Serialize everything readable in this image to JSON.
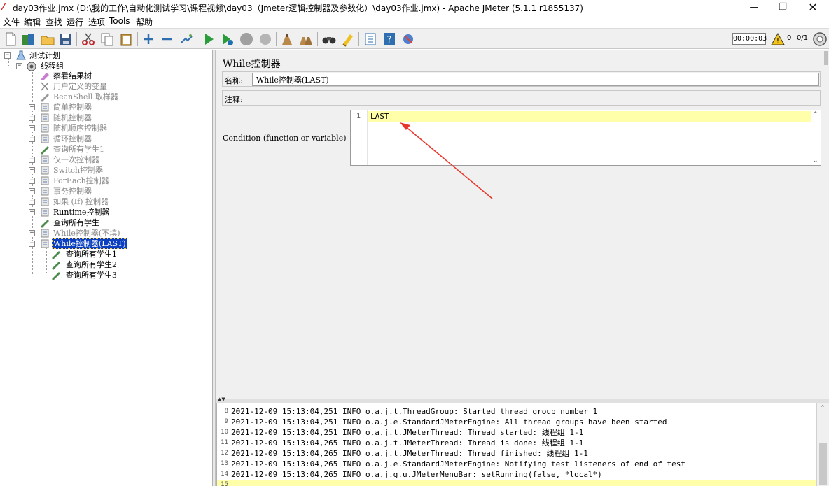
{
  "window": {
    "title": "day03作业.jmx (D:\\我的工作\\自动化测试学习\\课程视频\\day03（Jmeter逻辑控制器及参数化）\\day03作业.jmx) - Apache JMeter (5.1.1 r1855137)",
    "min_glyph": "—",
    "max_glyph": "❐",
    "close_glyph": "✕"
  },
  "menu": [
    "文件",
    "编辑",
    "查找",
    "运行",
    "选项",
    "Tools",
    "帮助"
  ],
  "toolbar": {
    "timer": "00:00:03",
    "error_count": "0",
    "threads": "0/1"
  },
  "tree": {
    "root": "测试计划",
    "thread_group": "线程组",
    "items": [
      {
        "label": "察看结果树"
      },
      {
        "label": "用户定义的变量"
      },
      {
        "label": "BeanShell 取样器"
      },
      {
        "label": "简单控制器"
      },
      {
        "label": "随机控制器"
      },
      {
        "label": "随机顺序控制器"
      },
      {
        "label": "循环控制器"
      },
      {
        "label": "查询所有学生1"
      },
      {
        "label": "仅一次控制器"
      },
      {
        "label": "Switch控制器"
      },
      {
        "label": "ForEach控制器"
      },
      {
        "label": "事务控制器"
      },
      {
        "label": "如果 (If) 控制器"
      },
      {
        "label": "Runtime控制器"
      },
      {
        "label": "查询所有学生"
      },
      {
        "label": "While控制器(不填)"
      },
      {
        "label": "While控制器(LAST)"
      },
      {
        "label": "查询所有学生1"
      },
      {
        "label": "查询所有学生2"
      },
      {
        "label": "查询所有学生3"
      }
    ]
  },
  "editor": {
    "title": "While控制器",
    "name_label": "名称:",
    "name_value": "While控制器(LAST)",
    "comment_label": "注释:",
    "comment_value": "",
    "condition_label": "Condition (function or variable)",
    "condition_line_number": "1",
    "condition_value": "LAST"
  },
  "log": [
    {
      "num": "8",
      "text": "2021-12-09 15:13:04,251 INFO o.a.j.t.ThreadGroup: Started thread group number 1"
    },
    {
      "num": "9",
      "text": "2021-12-09 15:13:04,251 INFO o.a.j.e.StandardJMeterEngine: All thread groups have been started"
    },
    {
      "num": "10",
      "text": "2021-12-09 15:13:04,251 INFO o.a.j.t.JMeterThread: Thread started: 线程组 1-1"
    },
    {
      "num": "11",
      "text": "2021-12-09 15:13:04,265 INFO o.a.j.t.JMeterThread: Thread is done: 线程组 1-1"
    },
    {
      "num": "12",
      "text": "2021-12-09 15:13:04,265 INFO o.a.j.t.JMeterThread: Thread finished: 线程组 1-1"
    },
    {
      "num": "13",
      "text": "2021-12-09 15:13:04,265 INFO o.a.j.e.StandardJMeterEngine: Notifying test listeners of end of test"
    },
    {
      "num": "14",
      "text": "2021-12-09 15:13:04,265 INFO o.a.j.g.u.JMeterMenuBar: setRunning(false, *local*)"
    },
    {
      "num": "15",
      "text": ""
    }
  ],
  "colors": {
    "accent_selection": "#0a3fbf",
    "current_line": "#ffffaa",
    "annotation_arrow": "#e8352a"
  }
}
